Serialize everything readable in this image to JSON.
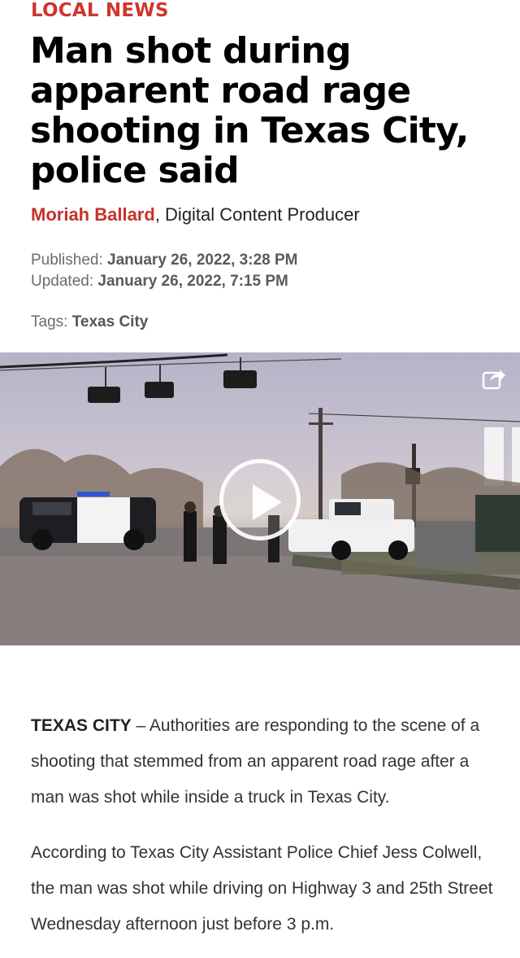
{
  "section": {
    "label": "LOCAL NEWS"
  },
  "headline": "Man shot during apparent road rage shooting in Texas City, police said",
  "byline": {
    "author": "Moriah Ballard",
    "role": ", Digital Content Producer"
  },
  "dates": {
    "published_label": "Published:",
    "published_value": "January 26, 2022, 3:28 PM",
    "updated_label": "Updated:",
    "updated_value": "January 26, 2022, 7:15 PM"
  },
  "tags": {
    "label": "Tags:",
    "items": [
      "Texas City"
    ]
  },
  "video": {
    "share_icon": "share-icon",
    "play_icon": "play-icon"
  },
  "article": {
    "dateline": "TEXAS CITY",
    "paragraph1": " – Authorities are responding to the scene of a shooting that stemmed from an apparent road rage after a man was shot while inside a truck in Texas City.",
    "paragraph2": "According to Texas City Assistant Police Chief Jess Colwell, the man was shot while driving on Highway 3 and 25th Street Wednesday afternoon just before 3 p.m."
  },
  "colors": {
    "accent": "#d0352b",
    "headline": "#000000",
    "meta": "#6b6b6b"
  }
}
